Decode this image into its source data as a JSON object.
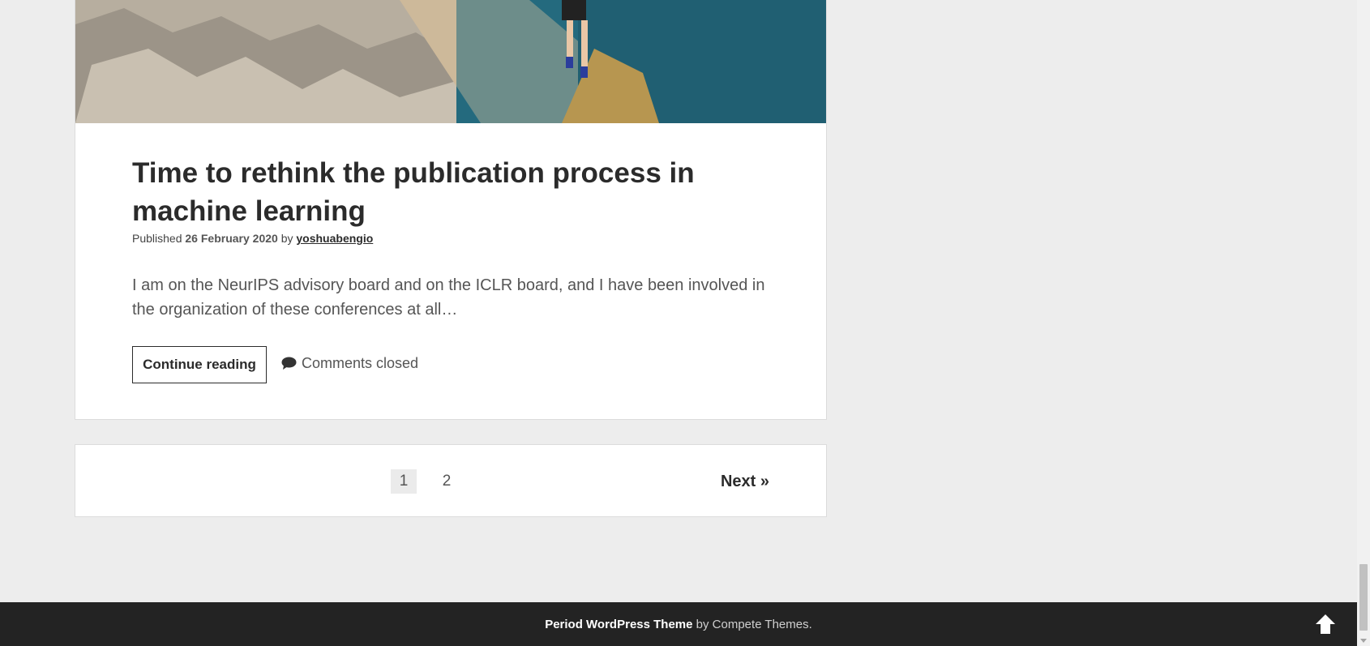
{
  "post": {
    "title": "Time to rethink the publication process in machine learning",
    "published_label": "Published",
    "date": "26 February 2020",
    "by_label": "by",
    "author": "yoshuabengio",
    "excerpt": "I am on the NeurIPS advisory board and on the ICLR board, and I have been involved in the organization of these conferences at all…",
    "continue_label": "Continue reading",
    "comments_label": "Comments closed",
    "image_icon": "landscape-photo"
  },
  "pagination": {
    "pages": [
      "1",
      "2"
    ],
    "current_page": "1",
    "next_label": "Next »"
  },
  "footer": {
    "theme_link": "Period WordPress Theme",
    "credit_suffix": "by Compete Themes.",
    "to_top_icon": "arrow-up-icon"
  },
  "colors": {
    "background": "#ededed",
    "footer": "#232323",
    "text": "#2b2b2b"
  }
}
